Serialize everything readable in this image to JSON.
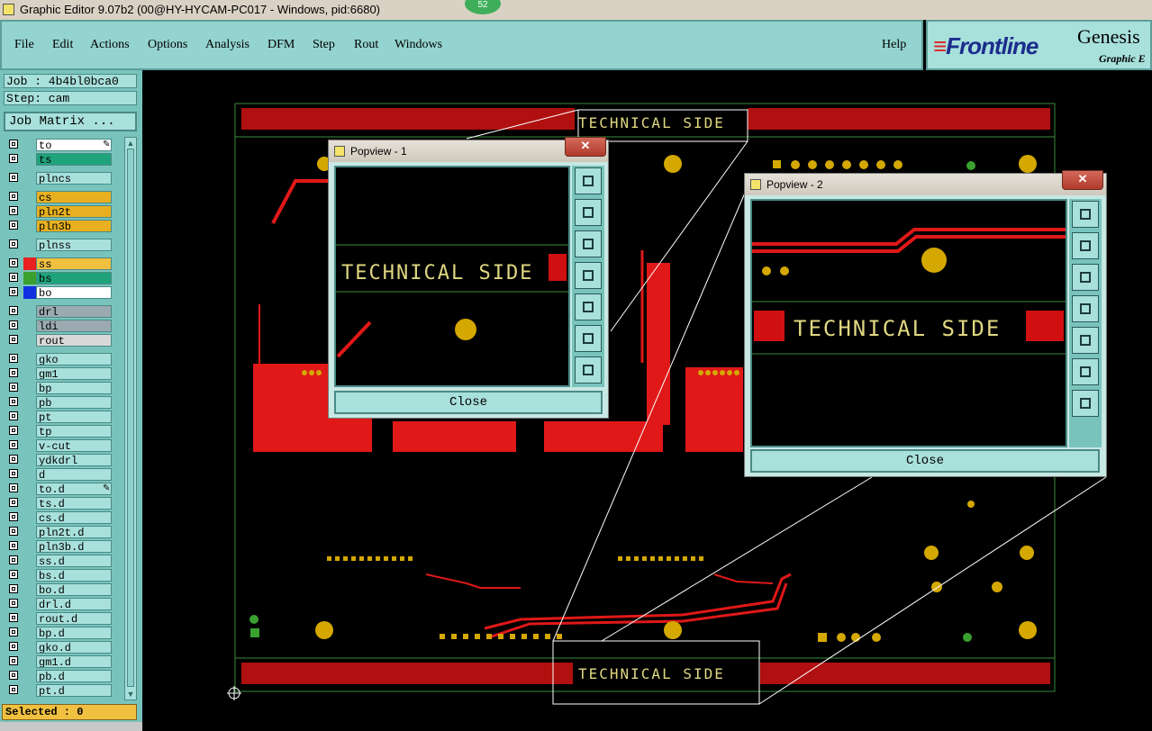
{
  "window": {
    "title": "Graphic Editor 9.07b2 (00@HY-HYCAM-PC017 - Windows, pid:6680)",
    "badge": "52"
  },
  "menu": {
    "items": [
      "File",
      "Edit",
      "Actions",
      "Options",
      "Analysis",
      "DFM",
      "Step",
      "Rout",
      "Windows"
    ],
    "help": "Help"
  },
  "logo": {
    "frontline": "Frontline",
    "genesis": "Genesis",
    "sub": "Graphic E"
  },
  "job": {
    "job_label": "Job : 4b4bl0bca0",
    "step_label": "Step: cam",
    "matrix_button": "Job Matrix ..."
  },
  "layers": [
    {
      "name": "to",
      "color": "#ffffff",
      "mark": true
    },
    {
      "name": "ts",
      "color": "#1fa37a"
    },
    {
      "name": "plncs",
      "color": "#a8e0dc"
    },
    {
      "name": "cs",
      "color": "#e8b020"
    },
    {
      "name": "pln2t",
      "color": "#e8b020"
    },
    {
      "name": "pln3b",
      "color": "#e8b020"
    },
    {
      "name": "plnss",
      "color": "#a8e0dc"
    },
    {
      "name": "ss",
      "color": "#f0c040",
      "swatch": "#e82020",
      "active": true
    },
    {
      "name": "bs",
      "color": "#1fa37a",
      "swatch": "#3aa030"
    },
    {
      "name": "bo",
      "color": "#ffffff",
      "swatch": "#1030e0"
    },
    {
      "name": "drl",
      "color": "#9aaab0"
    },
    {
      "name": "ldi",
      "color": "#9aaab0"
    },
    {
      "name": "rout",
      "color": "#d8d8d8"
    },
    {
      "name": "gko",
      "color": "#a8e0dc"
    },
    {
      "name": "gm1",
      "color": "#a8e0dc"
    },
    {
      "name": "bp",
      "color": "#a8e0dc"
    },
    {
      "name": "pb",
      "color": "#a8e0dc"
    },
    {
      "name": "pt",
      "color": "#a8e0dc"
    },
    {
      "name": "tp",
      "color": "#a8e0dc"
    },
    {
      "name": "v-cut",
      "color": "#a8e0dc"
    },
    {
      "name": "ydkdrl",
      "color": "#a8e0dc"
    },
    {
      "name": "d",
      "color": "#a8e0dc"
    },
    {
      "name": "to.d",
      "color": "#a8e0dc",
      "mark": true
    },
    {
      "name": "ts.d",
      "color": "#a8e0dc"
    },
    {
      "name": "cs.d",
      "color": "#a8e0dc"
    },
    {
      "name": "pln2t.d",
      "color": "#a8e0dc"
    },
    {
      "name": "pln3b.d",
      "color": "#a8e0dc"
    },
    {
      "name": "ss.d",
      "color": "#a8e0dc"
    },
    {
      "name": "bs.d",
      "color": "#a8e0dc"
    },
    {
      "name": "bo.d",
      "color": "#a8e0dc"
    },
    {
      "name": "drl.d",
      "color": "#a8e0dc"
    },
    {
      "name": "rout.d",
      "color": "#a8e0dc"
    },
    {
      "name": "bp.d",
      "color": "#a8e0dc"
    },
    {
      "name": "gko.d",
      "color": "#a8e0dc"
    },
    {
      "name": "gm1.d",
      "color": "#a8e0dc"
    },
    {
      "name": "pb.d",
      "color": "#a8e0dc"
    },
    {
      "name": "pt.d",
      "color": "#a8e0dc"
    }
  ],
  "status": {
    "selected": "Selected : 0"
  },
  "board": {
    "silk_text_left": "TECHNICAL",
    "silk_text_right": "SIDE"
  },
  "popview1": {
    "title": "Popview - 1",
    "close_label": "Close",
    "close_x": "✕"
  },
  "popview2": {
    "title": "Popview - 2",
    "close_label": "Close",
    "close_x": "✕"
  }
}
